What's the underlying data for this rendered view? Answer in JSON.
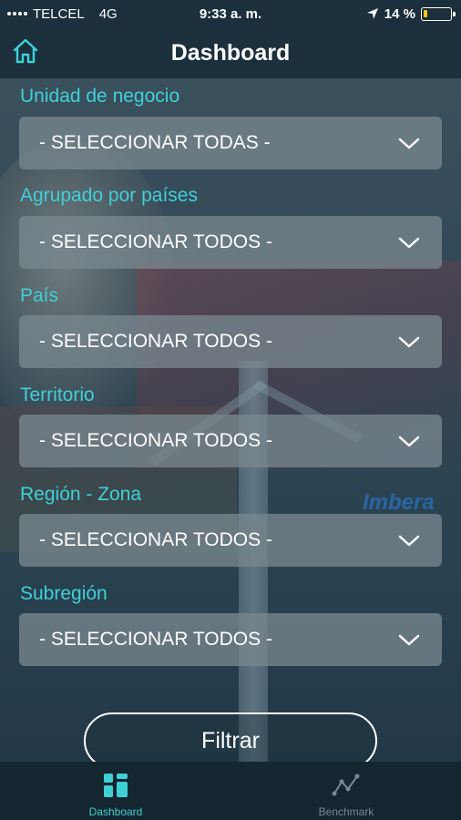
{
  "status_bar": {
    "carrier": "TELCEL",
    "network": "4G",
    "time": "9:33 a. m.",
    "battery": "14 %",
    "battery_level": 0.14
  },
  "header": {
    "title": "Dashboard",
    "home_icon": "home-icon"
  },
  "background": {
    "brand_text": "Imbera"
  },
  "filters": [
    {
      "label": "Unidad de negocio",
      "value": "- SELECCIONAR TODAS -"
    },
    {
      "label": "Agrupado por países",
      "value": "- SELECCIONAR TODOS -"
    },
    {
      "label": "País",
      "value": "- SELECCIONAR TODOS -"
    },
    {
      "label": "Territorio",
      "value": "- SELECCIONAR TODOS -"
    },
    {
      "label": "Región - Zona",
      "value": "- SELECCIONAR TODOS -"
    },
    {
      "label": "Subregión",
      "value": "- SELECCIONAR TODOS -"
    }
  ],
  "actions": {
    "filter_label": "Filtrar"
  },
  "tabs": [
    {
      "label": "Dashboard",
      "icon": "dashboard-icon",
      "active": true
    },
    {
      "label": "Benchmark",
      "icon": "benchmark-icon",
      "active": false
    }
  ],
  "colors": {
    "accent": "#3fd0d6",
    "background": "#1b2f3c",
    "battery": "#f0c419"
  }
}
